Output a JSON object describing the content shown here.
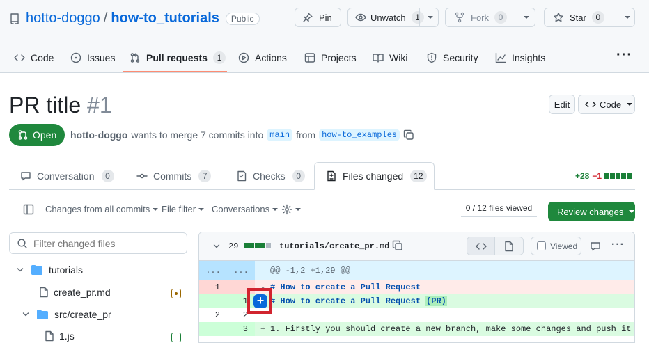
{
  "repo": {
    "owner": "hotto-doggo",
    "separator": "/",
    "name": "how-to_tutorials",
    "visibility": "Public"
  },
  "actions": {
    "pin": "Pin",
    "watch": {
      "label": "Unwatch",
      "count": "1"
    },
    "fork": {
      "label": "Fork",
      "count": "0"
    },
    "star": {
      "label": "Star",
      "count": "0"
    }
  },
  "nav": {
    "tabs": [
      {
        "label": "Code",
        "icon": "code-icon"
      },
      {
        "label": "Issues",
        "icon": "issue-icon"
      },
      {
        "label": "Pull requests",
        "icon": "pull-request-icon",
        "count": "1",
        "selected": true
      },
      {
        "label": "Actions",
        "icon": "play-icon"
      },
      {
        "label": "Projects",
        "icon": "table-icon"
      },
      {
        "label": "Wiki",
        "icon": "book-icon"
      },
      {
        "label": "Security",
        "icon": "shield-icon"
      },
      {
        "label": "Insights",
        "icon": "graph-icon"
      }
    ],
    "more": "···"
  },
  "pr": {
    "title": "PR title",
    "number": "#1",
    "edit": "Edit",
    "code": "Code",
    "state": "Open",
    "author": "hotto-doggo",
    "summary": "wants to merge 7 commits into",
    "base": "main",
    "from": "from",
    "head": "how-to_examples"
  },
  "pr_tabs": [
    {
      "label": "Conversation",
      "count": "0",
      "icon": "comment-icon"
    },
    {
      "label": "Commits",
      "count": "7",
      "icon": "commit-icon"
    },
    {
      "label": "Checks",
      "count": "0",
      "icon": "checklist-icon"
    },
    {
      "label": "Files changed",
      "count": "12",
      "icon": "file-diff-icon",
      "selected": true
    }
  ],
  "diffstat": {
    "additions": "+28",
    "deletions": "−1"
  },
  "toolbar": {
    "changes_from": "Changes from all commits",
    "file_filter": "File filter",
    "conversations": "Conversations",
    "files_viewed": "0 / 12 files viewed",
    "review": "Review changes"
  },
  "file_tree": {
    "filter_placeholder": "Filter changed files",
    "items": [
      {
        "name": "tutorials",
        "type": "folder"
      },
      {
        "name": "create_pr.md",
        "type": "file",
        "status": "modified"
      },
      {
        "name": "src/create_pr",
        "type": "folder"
      },
      {
        "name": "1.js",
        "type": "file",
        "status": "added"
      }
    ]
  },
  "diff_file": {
    "changes": "29",
    "path": "tutorials/create_pr.md",
    "viewed": "Viewed",
    "hunk_left": "...",
    "hunk_right": "...",
    "hunk": "@@ -1,2 +1,29 @@",
    "lines": [
      {
        "old": "1",
        "new": "",
        "kind": "del",
        "sign": "-",
        "text": "# How to create a Pull Request"
      },
      {
        "old": "",
        "new": "1",
        "kind": "add",
        "sign": "+",
        "text": "# How to create a Pull Request",
        "highlight": "(PR)"
      },
      {
        "old": "2",
        "new": "2",
        "kind": "ctx",
        "sign": "",
        "text": ""
      },
      {
        "old": "",
        "new": "3",
        "kind": "add",
        "sign": "+",
        "text": "1. Firstly you should create a new branch, make some changes and push it"
      }
    ]
  },
  "colors": {
    "accent": "#0969da",
    "green": "#1f883d",
    "red_highlight": "#d1242f",
    "nav_underline": "#fd8c73"
  }
}
